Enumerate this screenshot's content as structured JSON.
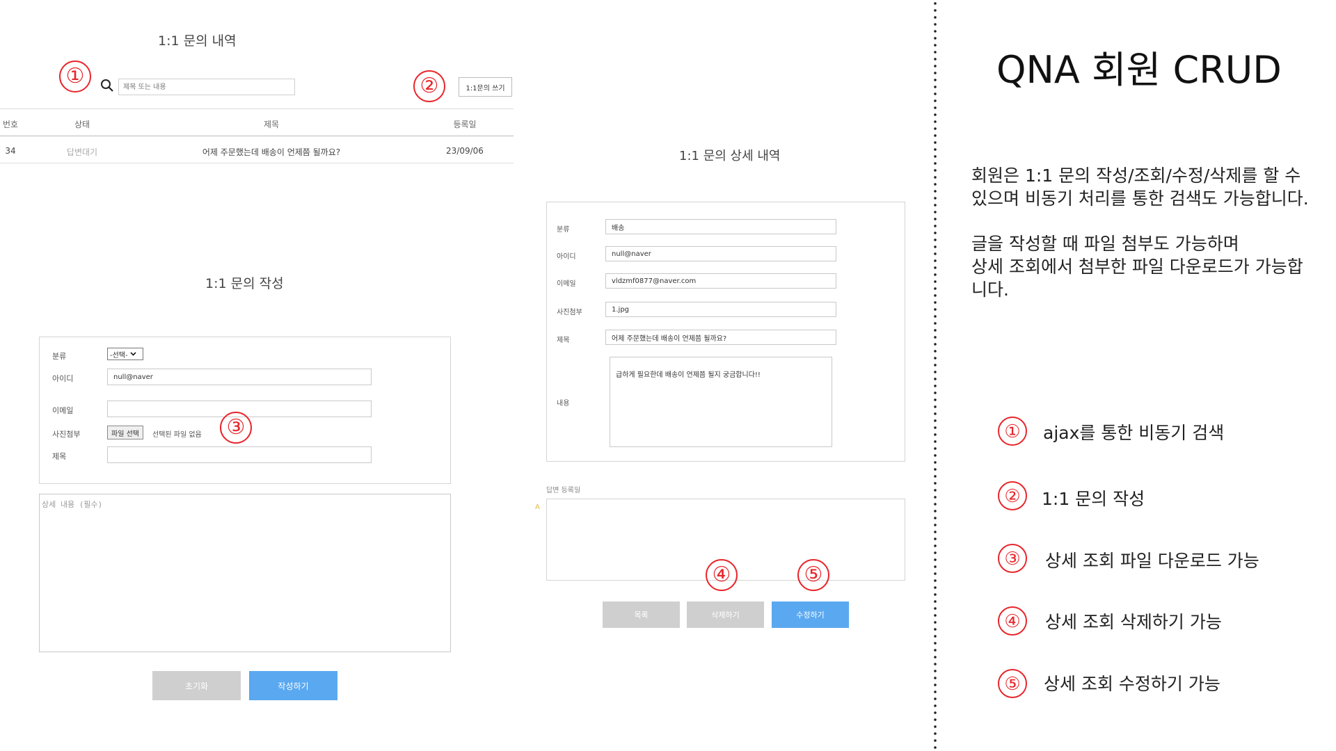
{
  "list": {
    "title": "1:1 문의 내역",
    "search_placeholder": "제목 또는 내용",
    "write_button": "1:1문의 쓰기",
    "headers": [
      "번호",
      "상태",
      "제목",
      "등록일"
    ],
    "rows": [
      {
        "no": "34",
        "status": "답변대기",
        "title": "어제 주문했는데 배송이 언제쯤 될까요?",
        "date": "23/09/06"
      }
    ]
  },
  "write_form": {
    "title": "1:1 문의 작성",
    "labels": {
      "category": "분류",
      "id": "아이디",
      "email": "이메일",
      "photo": "사진첨부",
      "subject": "제목"
    },
    "category_value": "-선택-",
    "id_value": "null@naver",
    "file_button": "파일 선택",
    "file_status": "선택된 파일 없음",
    "content_placeholder": "상세 내용 (필수)",
    "reset_button": "초기화",
    "submit_button": "작성하기"
  },
  "detail": {
    "title": "1:1 문의 상세 내역",
    "labels": {
      "category": "분류",
      "id": "아이디",
      "email": "이메일",
      "photo": "사진첨부",
      "subject": "제목",
      "content": "내용"
    },
    "category_value": "배송",
    "id_value": "null@naver",
    "email_value": "vldzmf0877@naver.com",
    "photo_value": "1.jpg",
    "subject_value": "어제 주문했는데 배송이 언제쯤 될까요?",
    "content_value": "급하게 필요한데 배송이 언제쯤 될지 궁금합니다!!",
    "answer_label": "답변 등록일",
    "answer_marker": "A",
    "list_button": "목록",
    "delete_button": "삭제하기",
    "edit_button": "수정하기"
  },
  "markers": [
    "①",
    "②",
    "③",
    "④",
    "⑤"
  ],
  "panel": {
    "title": "QNA 회원 CRUD",
    "desc1": [
      "회원은 1:1 문의 작성/조회/수정/삭제를 할 수",
      "있으며 비동기 처리를 통한 검색도 가능합니다."
    ],
    "desc2": [
      "글을 작성할 때 파일 첨부도 가능하며",
      "상세 조회에서 첨부한 파일 다운로드가 가능합",
      "니다."
    ],
    "features": [
      {
        "num": "①",
        "text": "ajax를 통한 비동기 검색"
      },
      {
        "num": "②",
        "text": "1:1 문의 작성"
      },
      {
        "num": "③",
        "text": "상세 조회 파일 다운로드 가능"
      },
      {
        "num": "④",
        "text": "상세 조회 삭제하기 가능"
      },
      {
        "num": "⑤",
        "text": "상세 조회 수정하기 가능"
      }
    ]
  },
  "colors": {
    "accent_red": "#e8262b",
    "button_blue": "#5aa8f0",
    "button_gray": "#cfcfcf"
  }
}
